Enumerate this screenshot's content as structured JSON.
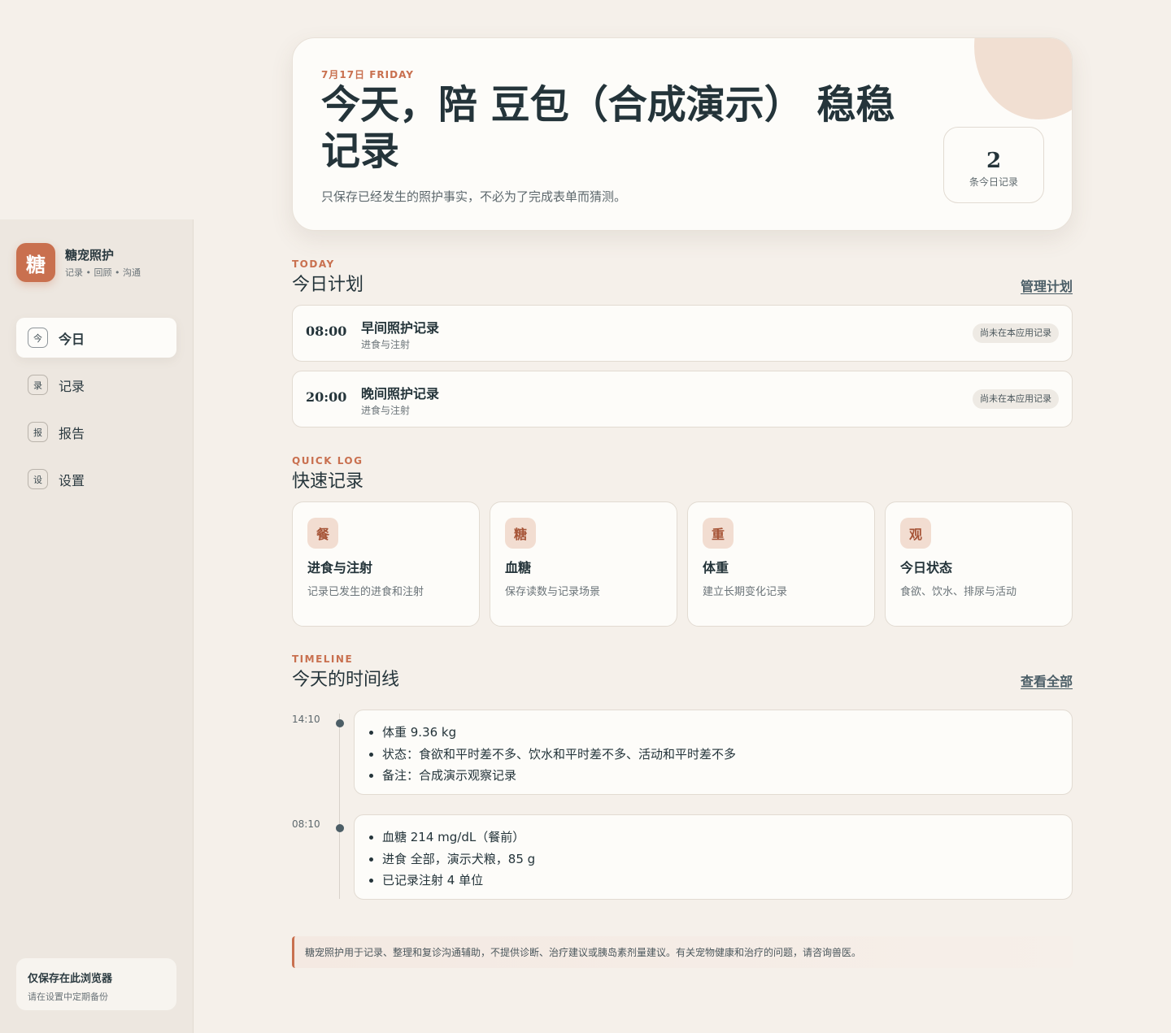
{
  "brand": {
    "logo": "糖",
    "name": "糖宠照护",
    "tagline": "记录 • 回顾 • 沟通"
  },
  "nav": [
    {
      "icon": "今",
      "label": "今日",
      "active": true
    },
    {
      "icon": "录",
      "label": "记录",
      "active": false
    },
    {
      "icon": "报",
      "label": "报告",
      "active": false
    },
    {
      "icon": "设",
      "label": "设置",
      "active": false
    }
  ],
  "storage": {
    "title": "仅保存在此浏览器",
    "subtitle": "请在设置中定期备份"
  },
  "hero": {
    "date": "7月17日 FRIDAY",
    "title": "今天，陪 豆包（合成演示） 稳稳记录",
    "subtitle": "只保存已经发生的照护事实，不必为了完成表单而猜测。",
    "count": "2",
    "count_label": "条今日记录"
  },
  "plan": {
    "kicker": "TODAY",
    "title": "今日计划",
    "link": "管理计划",
    "items": [
      {
        "time": "08:00",
        "title": "早间照护记录",
        "subtitle": "进食与注射",
        "badge": "尚未在本应用记录"
      },
      {
        "time": "20:00",
        "title": "晚间照护记录",
        "subtitle": "进食与注射",
        "badge": "尚未在本应用记录"
      }
    ]
  },
  "quick": {
    "kicker": "QUICK LOG",
    "title": "快速记录",
    "items": [
      {
        "icon": "餐",
        "title": "进食与注射",
        "desc": "记录已发生的进食和注射"
      },
      {
        "icon": "糖",
        "title": "血糖",
        "desc": "保存读数与记录场景"
      },
      {
        "icon": "重",
        "title": "体重",
        "desc": "建立长期变化记录"
      },
      {
        "icon": "观",
        "title": "今日状态",
        "desc": "食欲、饮水、排尿与活动"
      }
    ]
  },
  "timeline": {
    "kicker": "TIMELINE",
    "title": "今天的时间线",
    "link": "查看全部",
    "entries": [
      {
        "time": "14:10",
        "lines": [
          "体重 9.36 kg",
          "状态：食欲和平时差不多、饮水和平时差不多、活动和平时差不多",
          "备注：合成演示观察记录"
        ]
      },
      {
        "time": "08:10",
        "lines": [
          "血糖 214 mg/dL（餐前）",
          "进食 全部，演示犬粮，85 g",
          "已记录注射 4 单位"
        ]
      }
    ]
  },
  "disclaimer": "糖宠照护用于记录、整理和复诊沟通辅助，不提供诊断、治疗建议或胰岛素剂量建议。有关宠物健康和治疗的问题，请咨询兽医。",
  "colors": {
    "accent": "#c9704f",
    "background": "#f5f0ea",
    "card": "#fdfcf9",
    "text": "#24343a"
  }
}
